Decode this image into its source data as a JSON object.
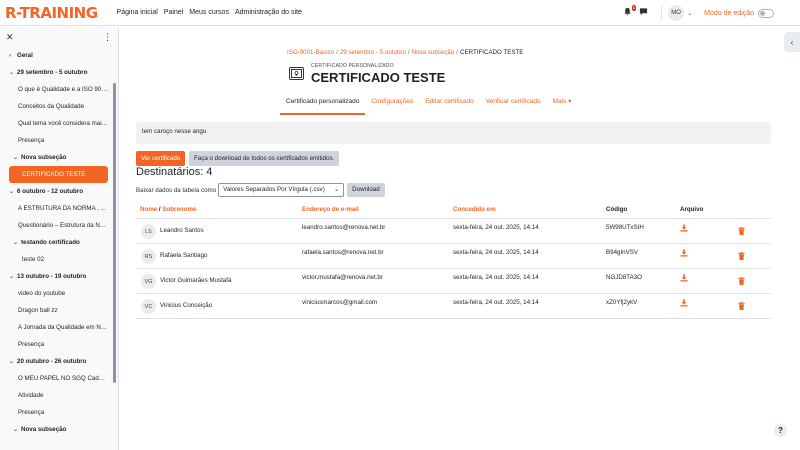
{
  "navbar": {
    "logo": "R-TRAINING",
    "links": [
      "Página inicial",
      "Painel",
      "Meus cursos",
      "Administração do site"
    ],
    "notification_count": "1",
    "user_initials": "MO",
    "edit_mode_label": "Modo de edição"
  },
  "drawer": {
    "items": [
      {
        "label": "Geral",
        "type": "section-collapsed"
      },
      {
        "label": "29 setembro - 5 outubro",
        "type": "section"
      },
      {
        "label": "O que é Qualidade e a ISO 9000...",
        "type": "item"
      },
      {
        "label": "Conceitos da Qualidade",
        "type": "item"
      },
      {
        "label": "Qual tema você considera mais...",
        "type": "item"
      },
      {
        "label": "Presença",
        "type": "item"
      },
      {
        "label": "Nova subseção",
        "type": "subsection"
      },
      {
        "label": "CERTIFICADO TESTE",
        "type": "active"
      },
      {
        "label": "6 outubro - 12 outubro",
        "type": "section"
      },
      {
        "label": "A ESTRUTURA DA NORMA , A ...",
        "type": "item"
      },
      {
        "label": "Questionário – Estrutura da No...",
        "type": "item"
      },
      {
        "label": "testando certificado",
        "type": "subsection"
      },
      {
        "label": "teste 02",
        "type": "subitem"
      },
      {
        "label": "13 outubro - 19 outubro",
        "type": "section"
      },
      {
        "label": "video do youtube",
        "type": "item"
      },
      {
        "label": "Dragon ball zz",
        "type": "item"
      },
      {
        "label": "A Jornada da Qualidade em Nã...",
        "type": "item"
      },
      {
        "label": "Presença",
        "type": "item"
      },
      {
        "label": "20 outubro - 26 outubro",
        "type": "section"
      },
      {
        "label": "O MEU PAPEL NO SGQ Cada P...",
        "type": "item"
      },
      {
        "label": "Atividade",
        "type": "item"
      },
      {
        "label": "Presença",
        "type": "item"
      },
      {
        "label": "Nova subseção",
        "type": "subsection"
      }
    ]
  },
  "breadcrumb": [
    "ISO-9001-Basico",
    "29 setembro - 5 outubro",
    "Nova subseção",
    "CERTIFICADO TESTE"
  ],
  "header": {
    "subtitle": "CERTIFICADO PERSONALIZADO",
    "title": "CERTIFICADO TESTE"
  },
  "tabs": [
    "Certificado personalizado",
    "Configurações",
    "Editar certificado",
    "Verificar certificado",
    "Mais"
  ],
  "notice": "tem caroço nesse angu",
  "buttons": {
    "view": "Ver certificado",
    "download_all": "Faça o download de todos os certificados emitidos."
  },
  "recipients_title": "Destinatários: 4",
  "download": {
    "label": "Baixar dados da tabela como",
    "selected": "Valores Separados Por Vírgula (.csv)",
    "button": "Download"
  },
  "table": {
    "headers": {
      "name": "Nome",
      "slash": " / ",
      "surname": "Sobrenome",
      "email": "Endereço de e-mail",
      "issued": "Concedido em",
      "code": "Código",
      "file": "Arquivo"
    },
    "rows": [
      {
        "initials": "LS",
        "name": "Leandro Santos",
        "email": "leandro.santos@renova.net.br",
        "issued": "sexta-feira, 24 out. 2025, 14:14",
        "code": "5W98UTxSIH"
      },
      {
        "initials": "RS",
        "name": "Rafaela Santiago",
        "email": "rafaela.santos@renova.net.br",
        "issued": "sexta-feira, 24 out. 2025, 14:14",
        "code": "B94gInVSV"
      },
      {
        "initials": "VG",
        "name": "Victor Guimarães Mustafá",
        "email": "victor.mustafa@renova.net.br",
        "issued": "sexta-feira, 24 out. 2025, 14:14",
        "code": "NGJD8TA3O"
      },
      {
        "initials": "VC",
        "name": "Vinicius Conceição",
        "email": "viniciusmarcos@gmail.com",
        "issued": "sexta-feira, 24 out. 2025, 14:14",
        "code": "xZ0Yfj2ykV"
      }
    ]
  },
  "colors": {
    "accent": "#f26522",
    "text": "#1d2125",
    "muted_bg": "#f2f2f2",
    "secondary_btn": "#ced4da"
  }
}
